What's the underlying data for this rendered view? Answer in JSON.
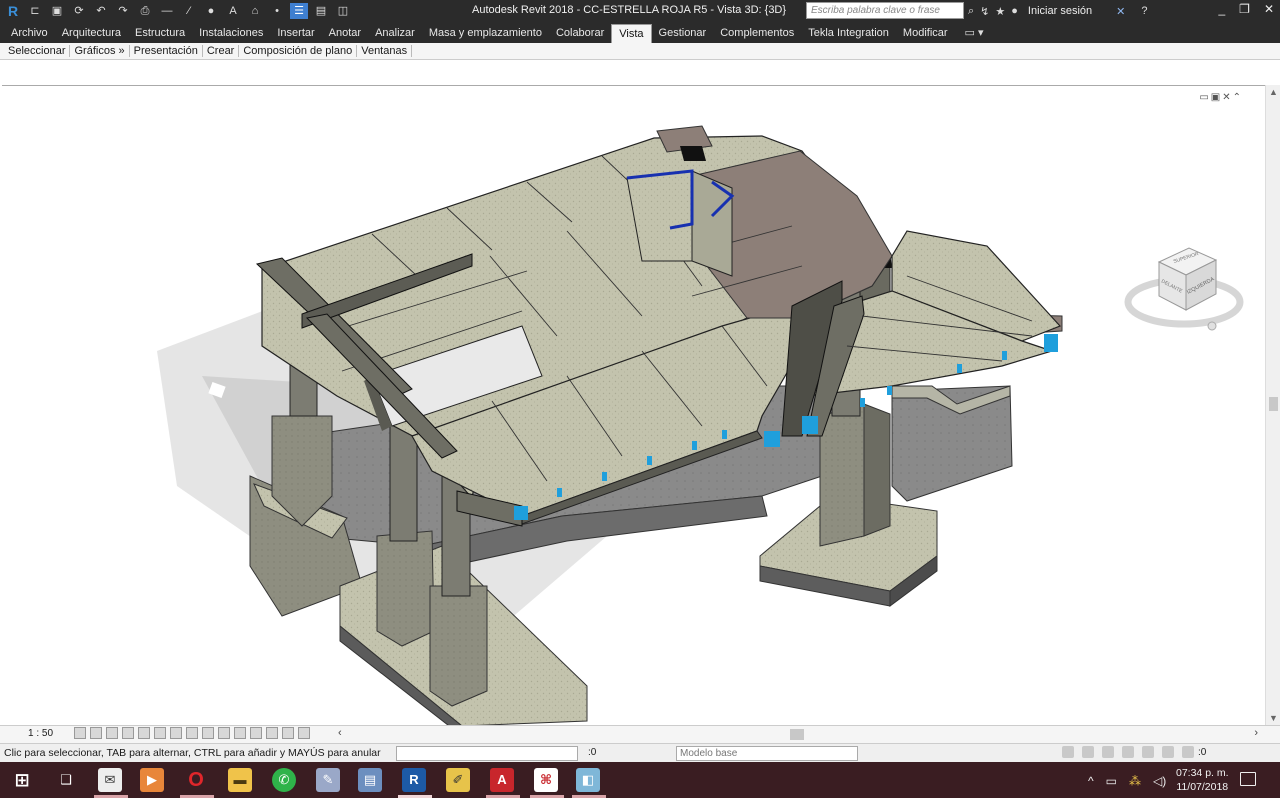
{
  "titlebar": {
    "app_title": "Autodesk Revit 2018 -    CC-ESTRELLA ROJA R5 - Vista 3D: {3D}",
    "search_placeholder": "Escriba palabra clave o frase",
    "signin_label": "Iniciar sesión"
  },
  "ribbon": {
    "tabs": [
      "Archivo",
      "Arquitectura",
      "Estructura",
      "Instalaciones",
      "Insertar",
      "Anotar",
      "Analizar",
      "Masa y emplazamiento",
      "Colaborar",
      "Vista",
      "Gestionar",
      "Complementos",
      "Tekla Integration",
      "Modificar"
    ],
    "active_tab": "Vista",
    "panels": [
      "Seleccionar",
      "Gráficos »",
      "Presentación",
      "Crear",
      "Composición de plano",
      "Ventanas"
    ]
  },
  "viewcube": {
    "face_top": "SUPERIOR",
    "face_front": "DELANTE",
    "face_left": "IZQUIERDA"
  },
  "view_bar": {
    "scale": "1 : 50"
  },
  "status_bar": {
    "message": "Clic para seleccionar, TAB para alternar, CTRL para añadir y MAYÚS para anular",
    "selection_count": ":0",
    "model_combo": "Modelo base",
    "filter_count": ":0"
  },
  "taskbar": {
    "time": "07:34 p. m.",
    "date": "11/07/2018",
    "icons": [
      "start-icon",
      "task-view-icon",
      "mail-icon",
      "media-player-icon",
      "opera-icon",
      "file-explorer-icon",
      "whatsapp-icon",
      "paint-icon",
      "network-icon",
      "revit-icon",
      "tool-icon",
      "autocad-icon",
      "pdf-icon",
      "app-icon"
    ]
  },
  "colors": {
    "titlebar_bg": "#2b2b2b",
    "taskbar_bg": "#3a1d22",
    "concrete": "#b8b8a4",
    "section_blue": "#1f9fdc"
  }
}
